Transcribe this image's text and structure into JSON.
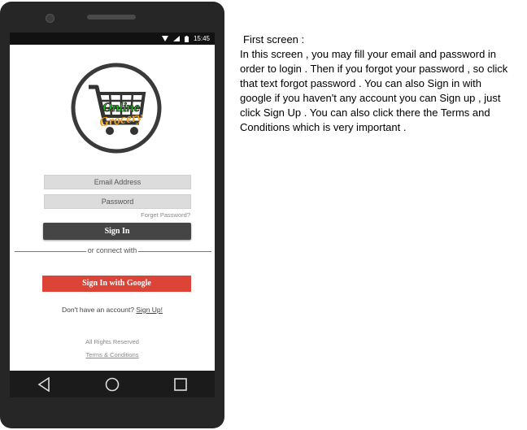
{
  "status_bar": {
    "time": "15:45",
    "icons": [
      "wifi-icon",
      "signal-icon",
      "battery-icon"
    ]
  },
  "logo": {
    "line1": "Online",
    "line2": "Grocery"
  },
  "login": {
    "email_placeholder": "Email Address",
    "password_placeholder": "Password",
    "forgot_label": "Forget Password?",
    "signin_label": "Sign In",
    "or_label": "or connect with",
    "google_label": "Sign In with Google",
    "no_account_label": "Don't have an account?",
    "signup_label": "Sign Up!",
    "rights_label": "All Rights Reserved",
    "terms_label": "Terms & Conditions"
  },
  "description": {
    "title": "First screen :",
    "body": "In this screen , you may fill your email and password in order to login . Then if you forgot your password , so click that text forgot password . You can also Sign in with google if you haven't any account you can Sign up , just click Sign Up . You can also click there the Terms and Conditions which is very important ."
  },
  "colors": {
    "signin_bg": "#454545",
    "google_bg": "#db4437",
    "logo_green": "#22cc22",
    "logo_orange": "#f0a020"
  }
}
